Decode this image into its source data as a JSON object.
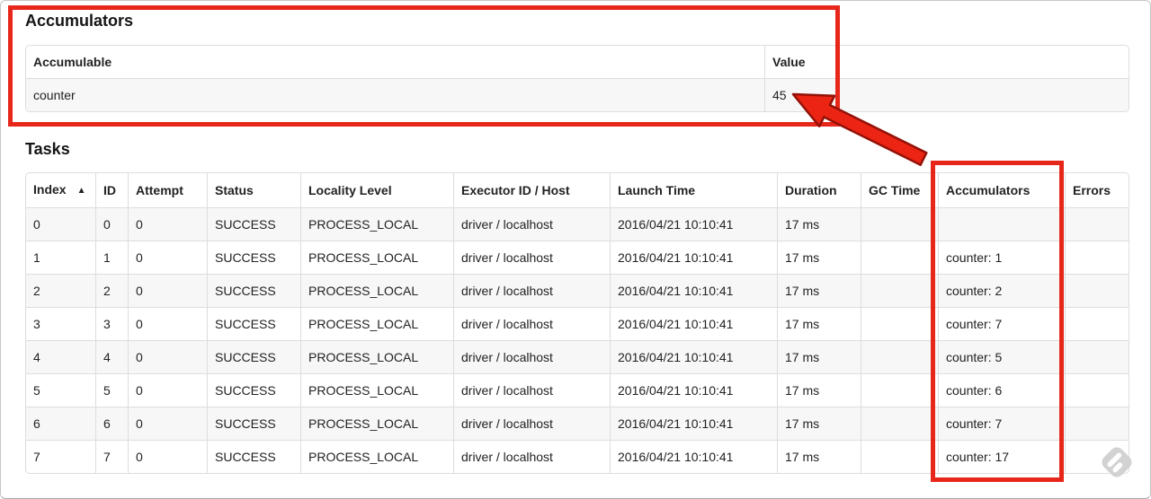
{
  "colors": {
    "annotation_red": "#e8271b",
    "annotation_red_dark": "#931107",
    "arrow_fill": "#ec2413",
    "table_border": "#dddddd",
    "stripe_bg": "#f7f7f7",
    "text": "#222222",
    "watermark_gray": "#d2d2d2"
  },
  "accumulators_section": {
    "title": "Accumulators",
    "table": {
      "headers": [
        "Accumulable",
        "Value"
      ],
      "rows": [
        {
          "accumulable": "counter",
          "value": "45"
        }
      ]
    }
  },
  "tasks_section": {
    "title": "Tasks",
    "table": {
      "headers": [
        "Index",
        "ID",
        "Attempt",
        "Status",
        "Locality Level",
        "Executor ID / Host",
        "Launch Time",
        "Duration",
        "GC Time",
        "Accumulators",
        "Errors"
      ],
      "sort_indicator": "▲",
      "sorted_column": "Index",
      "rows": [
        {
          "index": "0",
          "id": "0",
          "attempt": "0",
          "status": "SUCCESS",
          "locality_level": "PROCESS_LOCAL",
          "executor_id_host": "driver / localhost",
          "launch_time": "2016/04/21 10:10:41",
          "duration": "17 ms",
          "gc_time": "",
          "accumulators": "",
          "errors": ""
        },
        {
          "index": "1",
          "id": "1",
          "attempt": "0",
          "status": "SUCCESS",
          "locality_level": "PROCESS_LOCAL",
          "executor_id_host": "driver / localhost",
          "launch_time": "2016/04/21 10:10:41",
          "duration": "17 ms",
          "gc_time": "",
          "accumulators": "counter: 1",
          "errors": ""
        },
        {
          "index": "2",
          "id": "2",
          "attempt": "0",
          "status": "SUCCESS",
          "locality_level": "PROCESS_LOCAL",
          "executor_id_host": "driver / localhost",
          "launch_time": "2016/04/21 10:10:41",
          "duration": "17 ms",
          "gc_time": "",
          "accumulators": "counter: 2",
          "errors": ""
        },
        {
          "index": "3",
          "id": "3",
          "attempt": "0",
          "status": "SUCCESS",
          "locality_level": "PROCESS_LOCAL",
          "executor_id_host": "driver / localhost",
          "launch_time": "2016/04/21 10:10:41",
          "duration": "17 ms",
          "gc_time": "",
          "accumulators": "counter: 7",
          "errors": ""
        },
        {
          "index": "4",
          "id": "4",
          "attempt": "0",
          "status": "SUCCESS",
          "locality_level": "PROCESS_LOCAL",
          "executor_id_host": "driver / localhost",
          "launch_time": "2016/04/21 10:10:41",
          "duration": "17 ms",
          "gc_time": "",
          "accumulators": "counter: 5",
          "errors": ""
        },
        {
          "index": "5",
          "id": "5",
          "attempt": "0",
          "status": "SUCCESS",
          "locality_level": "PROCESS_LOCAL",
          "executor_id_host": "driver / localhost",
          "launch_time": "2016/04/21 10:10:41",
          "duration": "17 ms",
          "gc_time": "",
          "accumulators": "counter: 6",
          "errors": ""
        },
        {
          "index": "6",
          "id": "6",
          "attempt": "0",
          "status": "SUCCESS",
          "locality_level": "PROCESS_LOCAL",
          "executor_id_host": "driver / localhost",
          "launch_time": "2016/04/21 10:10:41",
          "duration": "17 ms",
          "gc_time": "",
          "accumulators": "counter: 7",
          "errors": ""
        },
        {
          "index": "7",
          "id": "7",
          "attempt": "0",
          "status": "SUCCESS",
          "locality_level": "PROCESS_LOCAL",
          "executor_id_host": "driver / localhost",
          "launch_time": "2016/04/21 10:10:41",
          "duration": "17 ms",
          "gc_time": "",
          "accumulators": "counter: 17",
          "errors": ""
        }
      ]
    }
  }
}
